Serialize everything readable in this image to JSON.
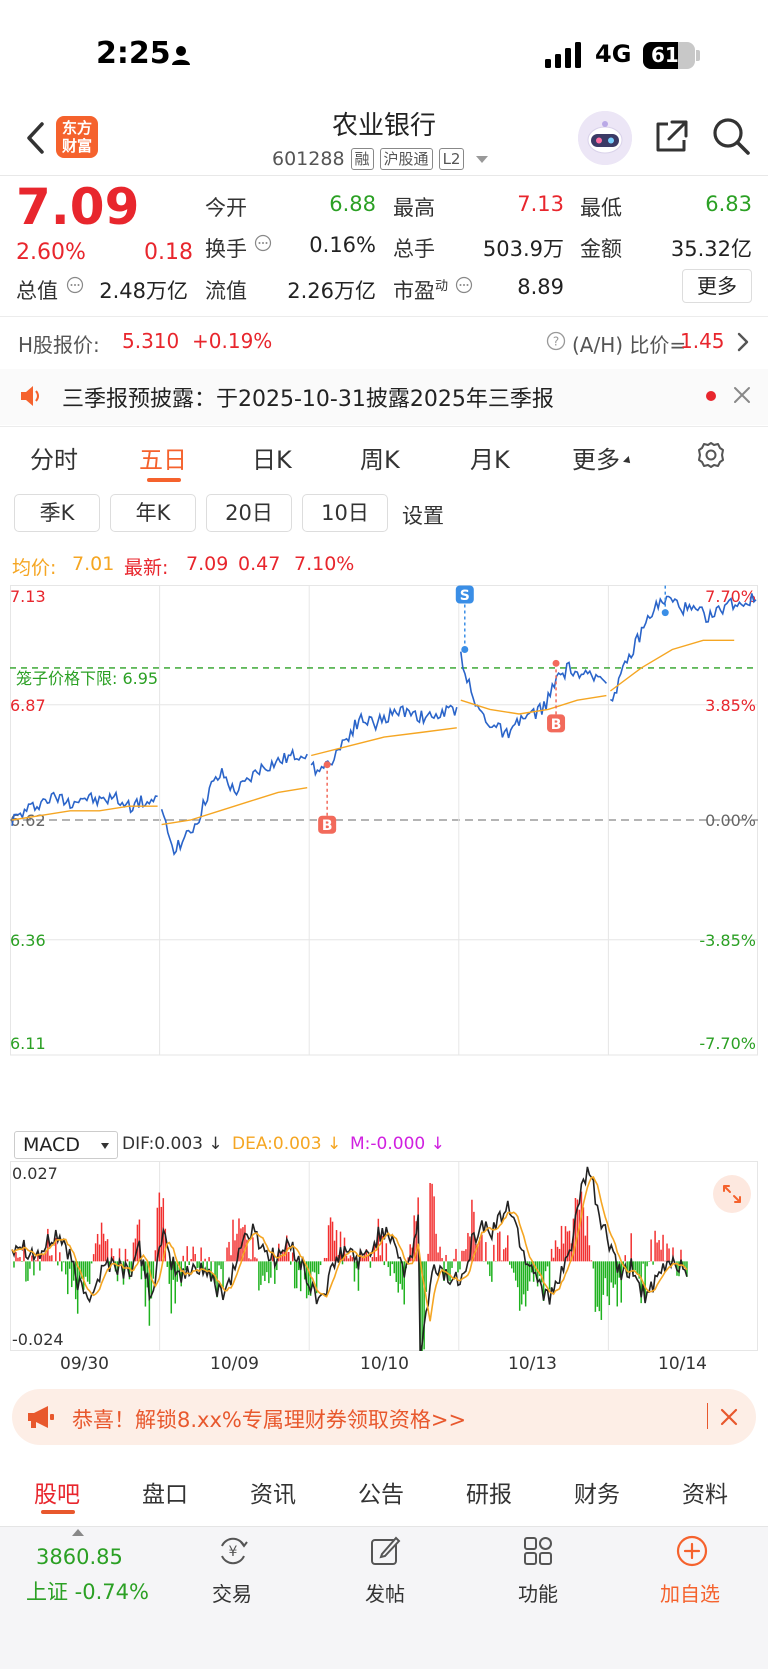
{
  "status_bar": {
    "time": "2:25",
    "network": "4G",
    "battery": "61"
  },
  "header": {
    "logo": "东方\n财富",
    "stock_name": "农业银行",
    "stock_code": "601288",
    "tags": [
      "融",
      "沪股通",
      "L2"
    ]
  },
  "quote": {
    "price": "7.09",
    "change_pct": "2.60%",
    "change": "0.18",
    "fields": [
      {
        "label": "今开",
        "value": "6.88",
        "color": "#2ba024"
      },
      {
        "label": "最高",
        "value": "7.13",
        "color": "#e8262d"
      },
      {
        "label": "最低",
        "value": "6.83",
        "color": "#2ba024"
      },
      {
        "label": "换手",
        "value": "0.16%",
        "color": "#222222"
      },
      {
        "label": "总手",
        "value": "503.9万",
        "color": "#222222"
      },
      {
        "label": "金额",
        "value": "35.32亿",
        "color": "#222222"
      },
      {
        "label": "总值",
        "value": "2.48万亿",
        "color": "#222222"
      },
      {
        "label": "流值",
        "value": "2.26万亿",
        "color": "#222222"
      },
      {
        "label": "市盈",
        "sup": "动",
        "value": "8.89",
        "color": "#222222"
      }
    ],
    "more_label": "更多"
  },
  "h_share": {
    "label": "H股报价:",
    "price": "5.310",
    "change": "+0.19%",
    "ah_label": "(A/H) 比价=",
    "ah_value": "1.45"
  },
  "notice": {
    "text": "三季报预披露：于2025-10-31披露2025年三季报"
  },
  "tabs": [
    "分时",
    "五日",
    "日K",
    "周K",
    "月K",
    "更多"
  ],
  "active_tab": "五日",
  "chips": [
    "季K",
    "年K",
    "20日",
    "10日"
  ],
  "chip_settings": "设置",
  "legend": {
    "avg_label": "均价:",
    "avg_value": "7.01",
    "latest_label": "最新:",
    "latest_value": "7.09",
    "latest_change": "0.47",
    "latest_pct": "7.10%"
  },
  "chart_data": {
    "type": "line",
    "title": "",
    "y_left_ticks": [
      "7.13",
      "6.87",
      "6.62",
      "6.36",
      "6.11"
    ],
    "y_right_ticks": [
      "7.70%",
      "3.85%",
      "0.00%",
      "-3.85%",
      "-7.70%"
    ],
    "ylim": [
      6.11,
      7.13
    ],
    "base_price": 6.62,
    "cage_lower_label": "笼子价格下限: 6.95",
    "cage_lower_value": 6.95,
    "x_dates": [
      "09/30",
      "10/09",
      "10/10",
      "10/13",
      "10/14"
    ],
    "series": [
      {
        "color": "#2a64c9",
        "days": [
          [
            6.62,
            6.64,
            6.66,
            6.67,
            6.66,
            6.67,
            6.66,
            6.67,
            6.65,
            6.66,
            6.66
          ],
          [
            6.63,
            6.56,
            6.58,
            6.62,
            6.69,
            6.72,
            6.68,
            6.7,
            6.73,
            6.74,
            6.75,
            6.76,
            6.77
          ],
          [
            6.73,
            6.74,
            6.79,
            6.84,
            6.83,
            6.85,
            6.86,
            6.84,
            6.85,
            6.86
          ],
          [
            6.98,
            6.88,
            6.84,
            6.82,
            6.8,
            6.84,
            6.85,
            6.87,
            6.93,
            6.95,
            6.93,
            6.93,
            6.93
          ],
          [
            6.88,
            6.95,
            7.02,
            7.08,
            7.1,
            7.08,
            7.07,
            7.06,
            7.09,
            7.09,
            7.1
          ]
        ]
      },
      {
        "color": "#f5a623",
        "days": [
          [
            6.62,
            6.63,
            6.64,
            6.64,
            6.65,
            6.65
          ],
          [
            6.61,
            6.62,
            6.64,
            6.66,
            6.68,
            6.69
          ],
          [
            6.76,
            6.78,
            6.8,
            6.81,
            6.82
          ],
          [
            6.88,
            6.86,
            6.85,
            6.86,
            6.88,
            6.89
          ],
          [
            6.9,
            6.95,
            6.99,
            7.01,
            7.01
          ]
        ]
      }
    ],
    "markers": [
      {
        "label": "B",
        "day": 2,
        "pos": 0.12,
        "value": 6.74
      },
      {
        "label": "S",
        "day": 3,
        "pos": 0.04,
        "value": 6.99
      },
      {
        "label": "B",
        "day": 3,
        "pos": 0.65,
        "value": 6.96
      },
      {
        "label": "S",
        "day": 4,
        "pos": 0.38,
        "value": 7.07
      }
    ]
  },
  "macd": {
    "selector": "MACD",
    "dif": "DIF:0.003",
    "dea": "DEA:0.003",
    "m": "M:-0.000",
    "y_top": "0.027",
    "y_bottom": "-0.024",
    "ylim": [
      -0.024,
      0.027
    ]
  },
  "promo": {
    "text": "恭喜！解锁8.xx%专属理财券领取资格>>"
  },
  "bottom_tabs": [
    "股吧",
    "盘口",
    "资讯",
    "公告",
    "研报",
    "财务",
    "资料"
  ],
  "footer": {
    "index_value": "3860.85",
    "index_name": "上证 -0.74%",
    "buttons": [
      {
        "label": "交易",
        "icon": "yuan-exchange-icon"
      },
      {
        "label": "发帖",
        "icon": "edit-post-icon"
      },
      {
        "label": "功能",
        "icon": "grid-apps-icon"
      },
      {
        "label": "加自选",
        "icon": "plus-circle-icon"
      }
    ]
  }
}
